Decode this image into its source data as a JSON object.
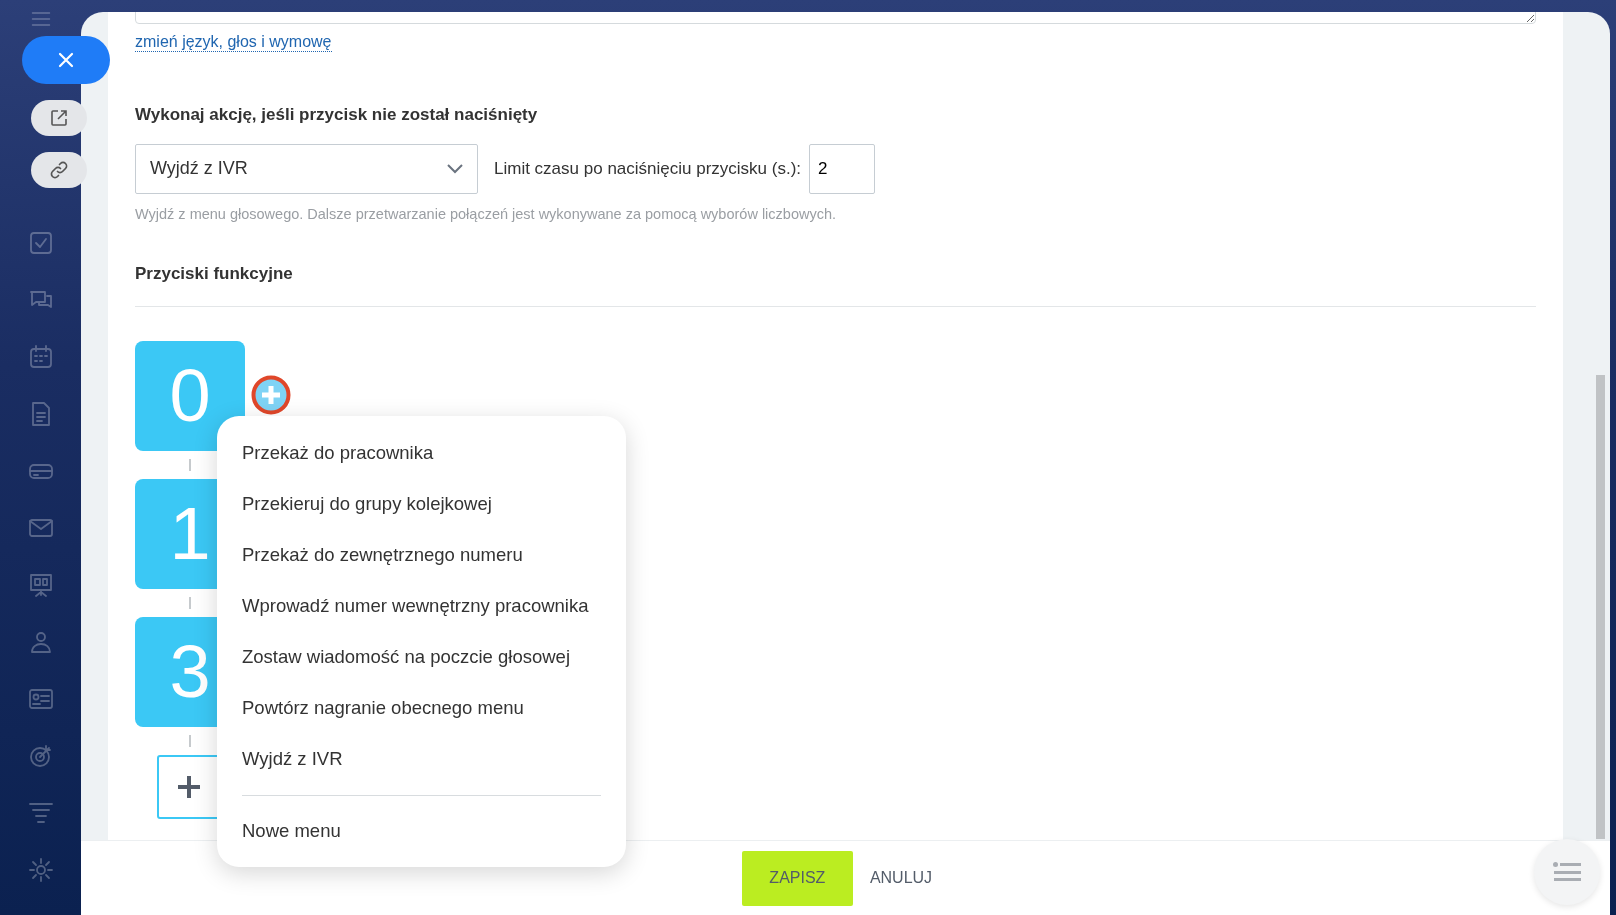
{
  "voice_link": "zmień język, głos i wymowę",
  "no_press_section": {
    "title": "Wykonaj akcję, jeśli przycisk nie został naciśnięty",
    "action_select": {
      "value": "Wyjdź z IVR"
    },
    "timeout_label": "Limit czasu po naciśnięciu przycisku (s.):",
    "timeout_input": {
      "value": "2"
    },
    "hint": "Wyjdź z menu głosowego. Dalsze przetwarzanie połączeń jest wykonywane za pomocą wyborów liczbowych."
  },
  "function_keys": {
    "title": "Przyciski funkcyjne",
    "keys": [
      "0",
      "1",
      "3"
    ]
  },
  "action_menu": {
    "items": [
      "Przekaż do pracownika",
      "Przekieruj do grupy kolejkowej",
      "Przekaż do zewnętrznego numeru",
      "Wprowadź numer wewnętrzny pracownika",
      "Zostaw wiadomość na poczcie głosowej",
      "Powtórz nagranie obecnego menu",
      "Wyjdź z IVR"
    ],
    "extra_items": [
      "Nowe menu"
    ]
  },
  "footer": {
    "buttons": [
      {
        "label": "ZAPISZ",
        "kind": "primary"
      },
      {
        "label": "ANULUJ",
        "kind": "link"
      }
    ]
  }
}
